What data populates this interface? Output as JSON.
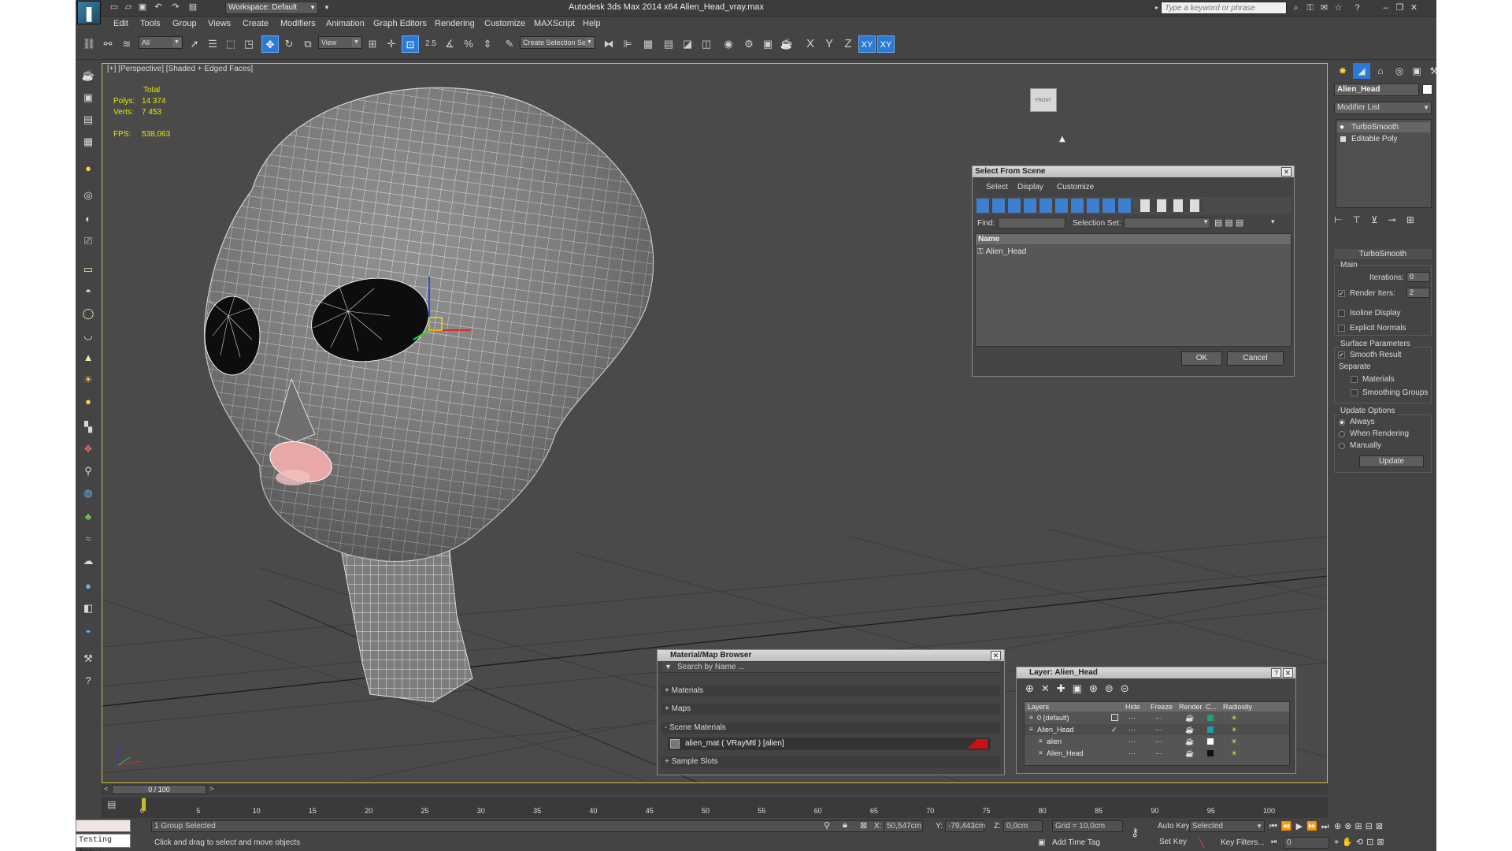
{
  "app": {
    "title": "Autodesk 3ds Max  2014 x64     Alien_Head_vray.max",
    "workspace": "Workspace: Default",
    "search_placeholder": "Type a keyword or phrase"
  },
  "menu": [
    "Edit",
    "Tools",
    "Group",
    "Views",
    "Create",
    "Modifiers",
    "Animation",
    "Graph Editors",
    "Rendering",
    "Customize",
    "MAXScript",
    "Help"
  ],
  "toolbar": {
    "selection_filter": "All",
    "ref_coord": "View",
    "named_selection": "Create Selection Se",
    "snap_label": "2.5",
    "angle_label": "%",
    "axes": [
      "X",
      "Y",
      "Z",
      "XY",
      "XY"
    ]
  },
  "viewport": {
    "label": "[+] [Perspective] [Shaded + Edged Faces]",
    "stats": {
      "total_label": "Total",
      "polys_label": "Polys:",
      "polys": "14 374",
      "verts_label": "Verts:",
      "verts": "7 453",
      "fps_label": "FPS:",
      "fps": "538,063"
    },
    "viewcube": "FRONT"
  },
  "command_panel": {
    "object_name": "Alien_Head",
    "modifier_list": "Modifier List",
    "stack": [
      "TurboSmooth",
      "Editable Poly"
    ],
    "turbosmooth": {
      "title": "TurboSmooth",
      "main": "Main",
      "iterations_label": "Iterations:",
      "iterations": "0",
      "render_iters_label": "Render Iters:",
      "render_iters": "2",
      "isoline": "Isoline Display",
      "explicit": "Explicit Normals",
      "surface_params": "Surface Parameters",
      "smooth_result": "Smooth Result",
      "separate": "Separate",
      "materials": "Materials",
      "smoothing_groups": "Smoothing Groups",
      "update_options": "Update Options",
      "always": "Always",
      "when_rendering": "When Rendering",
      "manually": "Manually",
      "update": "Update"
    }
  },
  "select_from_scene": {
    "title": "Select From Scene",
    "menu": [
      "Select",
      "Display",
      "Customize"
    ],
    "find_label": "Find:",
    "selection_set_label": "Selection Set:",
    "column": "Name",
    "items": [
      "Alien_Head"
    ],
    "ok": "OK",
    "cancel": "Cancel"
  },
  "material_browser": {
    "title": "Material/Map Browser",
    "search_placeholder": "Search by Name ...",
    "sections": [
      "+ Materials",
      "+ Maps",
      "- Scene Materials"
    ],
    "material": "alien_mat  ( VRayMtl )  [alien]",
    "sample_slots": "+ Sample Slots"
  },
  "layer_dialog": {
    "title": "Layer: Alien_Head",
    "help": "?",
    "columns": [
      "Layers",
      "Hide",
      "Freeze",
      "Render",
      "C...",
      "Radiosity"
    ],
    "rows": [
      "0 (default)",
      "Alien_Head",
      "alien",
      "Alien_Head"
    ],
    "row_colors": [
      "#1fa36b",
      "#19a0b0",
      "#ffffff",
      "#111111"
    ]
  },
  "timeline": {
    "frame": "0 / 100",
    "ticks": [
      "0",
      "5",
      "10",
      "15",
      "20",
      "25",
      "30",
      "35",
      "40",
      "45",
      "50",
      "55",
      "60",
      "65",
      "70",
      "75",
      "80",
      "85",
      "90",
      "95",
      "100"
    ]
  },
  "status": {
    "maxscript": "Testing for :",
    "selected": "1 Group Selected",
    "prompt": "Click and drag to select and move objects",
    "x_label": "X:",
    "x": "50,547cm",
    "y_label": "Y:",
    "y": "-79,443cm",
    "z_label": "Z:",
    "z": "0,0cm",
    "grid": "Grid = 10,0cm",
    "add_time_tag": "Add Time Tag",
    "auto_key": "Auto Key",
    "set_key": "Set Key",
    "selected_set": "Selected",
    "key_filters": "Key Filters...",
    "frame_field": "0"
  }
}
